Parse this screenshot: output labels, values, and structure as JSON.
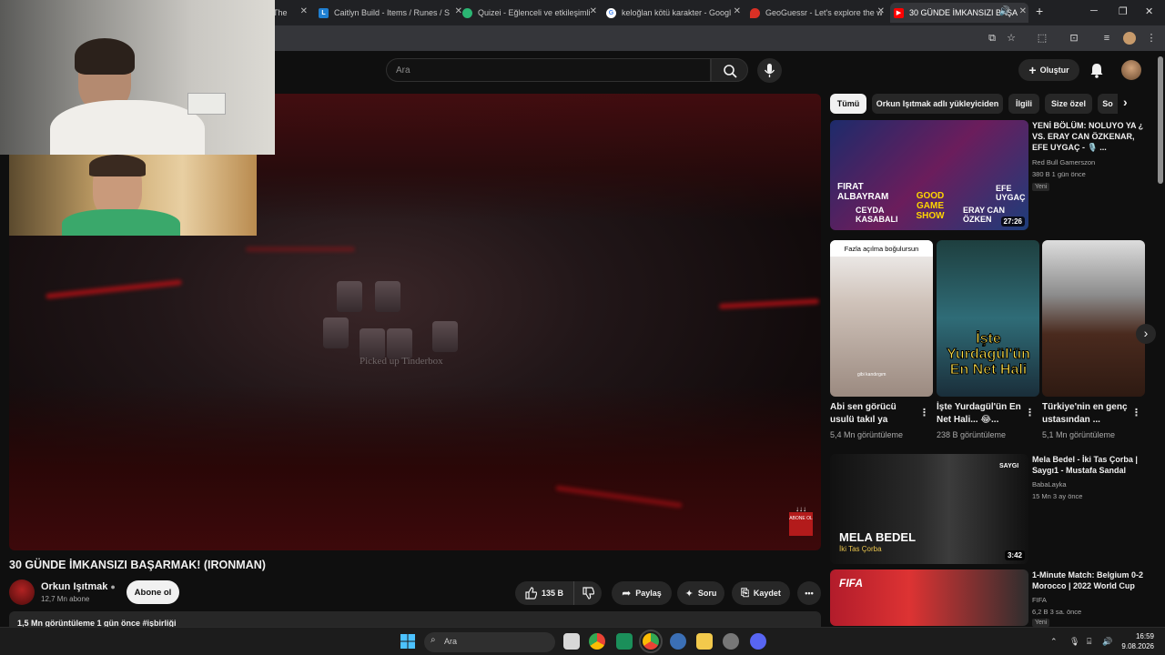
{
  "tabs": [
    {
      "title": "The",
      "color": "#1a73e8",
      "active": false
    },
    {
      "title": "Caitlyn Build - Items / Runes / S",
      "icon_letter": "L",
      "color": "#1f7fd1",
      "active": false
    },
    {
      "title": "Quizei - Eğlenceli ve etkileşimli",
      "color": "#2bb673",
      "active": false
    },
    {
      "title": "keloğlan kötü karakter - Googl",
      "color": "#ffffff",
      "active": false
    },
    {
      "title": "GeoGuessr - Let's explore the w",
      "color": "#d93025",
      "active": false
    },
    {
      "title": "30 GÜNDE İMKANSIZI BAŞA",
      "color": "#ff0000",
      "active": true
    }
  ],
  "youtube": {
    "search_placeholder": "Ara",
    "create_label": "Oluştur"
  },
  "video": {
    "overlay_text": "Picked up Tinderbox",
    "subscribe_badge": "ABONE OL",
    "title": "30 GÜNDE İMKANSIZI BAŞARMAK! (IRONMAN)",
    "channel": "Orkun Işıtmak",
    "subscribers": "12,7 Mn abone",
    "subscribe_label": "Abone ol",
    "likes": "135 B",
    "share_label": "Paylaş",
    "ask_label": "Soru",
    "save_label": "Kaydet",
    "views_line": "1,5 Mn görüntüleme  1 gün önce  #işbirliği"
  },
  "chips": [
    "Tümü",
    "Orkun Işıtmak adlı yükleyiciden",
    "İlgili",
    "Size özel",
    "So"
  ],
  "recommendations": [
    {
      "title": "YENİ BÖLÜM: NOLUYO YA ¿ VS. ERAY CAN ÖZKENAR, EFE UYGAÇ - 🎙️ ...",
      "channel": "Red Bull Gamerszon",
      "meta": "380 B  1 gün önce",
      "badge": "Yeni",
      "duration": "27:26",
      "thumb_text": [
        "FIRAT ALBAYRAM",
        "CEYDA KASABALI",
        "GOOD GAME SHOW",
        "EFE UYGAÇ",
        "ERAY CAN ÖZKEN"
      ]
    },
    {
      "title": "Mela Bedel - İki Tas Çorba | Saygı1 - Mustafa Sandal",
      "channel": "BabaLayka",
      "meta": "15 Mn  3 ay önce",
      "duration": "3:42",
      "thumb_text": [
        "MELA BEDEL",
        "İki Tas Çorba",
        "SAYGI"
      ]
    },
    {
      "title": "1-Minute Match: Belgium 0-2 Morocco | 2022 World Cup",
      "channel": "FIFA",
      "meta": "6,2 B  3 sa. önce",
      "badge": "Yeni",
      "thumb_text": [
        "FIFA"
      ]
    }
  ],
  "shorts": [
    {
      "title": "Abi sen görücü usulü takıl ya",
      "views": "5,4 Mn görüntüleme",
      "top_text": "Fazla açılma boğulursun",
      "caption": "gibi kandırgım"
    },
    {
      "title": "İşte Yurdagül'ün En Net Hali... 😂...",
      "views": "238 B görüntüleme",
      "top_text": "İşte Yurdagül'ün En Net Hali"
    },
    {
      "title": "Türkiye'nin en genç ustasından ...",
      "views": "5,1 Mn görüntüleme"
    }
  ],
  "taskbar": {
    "search_placeholder": "Ara",
    "time": "16:59",
    "date": "9.08.2026"
  }
}
